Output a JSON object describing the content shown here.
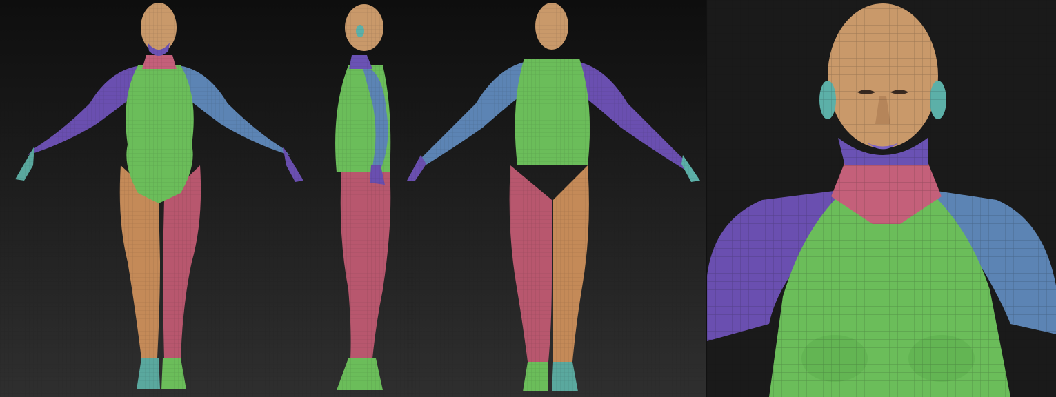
{
  "colors": {
    "background_top": "#0e0e0e",
    "background_bottom": "#2f2f2f",
    "head_skin": "#c9996a",
    "torso_green": "#6bbd5a",
    "neck_pink": "#c4607a",
    "leg_pink": "#b8576e",
    "leg_orange": "#c48a58",
    "arm_purple": "#6a4fb0",
    "arm_blue": "#5c84b4",
    "chin_purple": "#6a52b4",
    "foot_teal": "#5aa89e",
    "ear_teal": "#5cb0a8",
    "wire": "#1a1a1a"
  },
  "views": [
    {
      "id": "front",
      "label_icon": "front-view"
    },
    {
      "id": "side",
      "label_icon": "side-view"
    },
    {
      "id": "back",
      "label_icon": "back-view"
    },
    {
      "id": "closeup",
      "label_icon": "closeup-view"
    }
  ]
}
